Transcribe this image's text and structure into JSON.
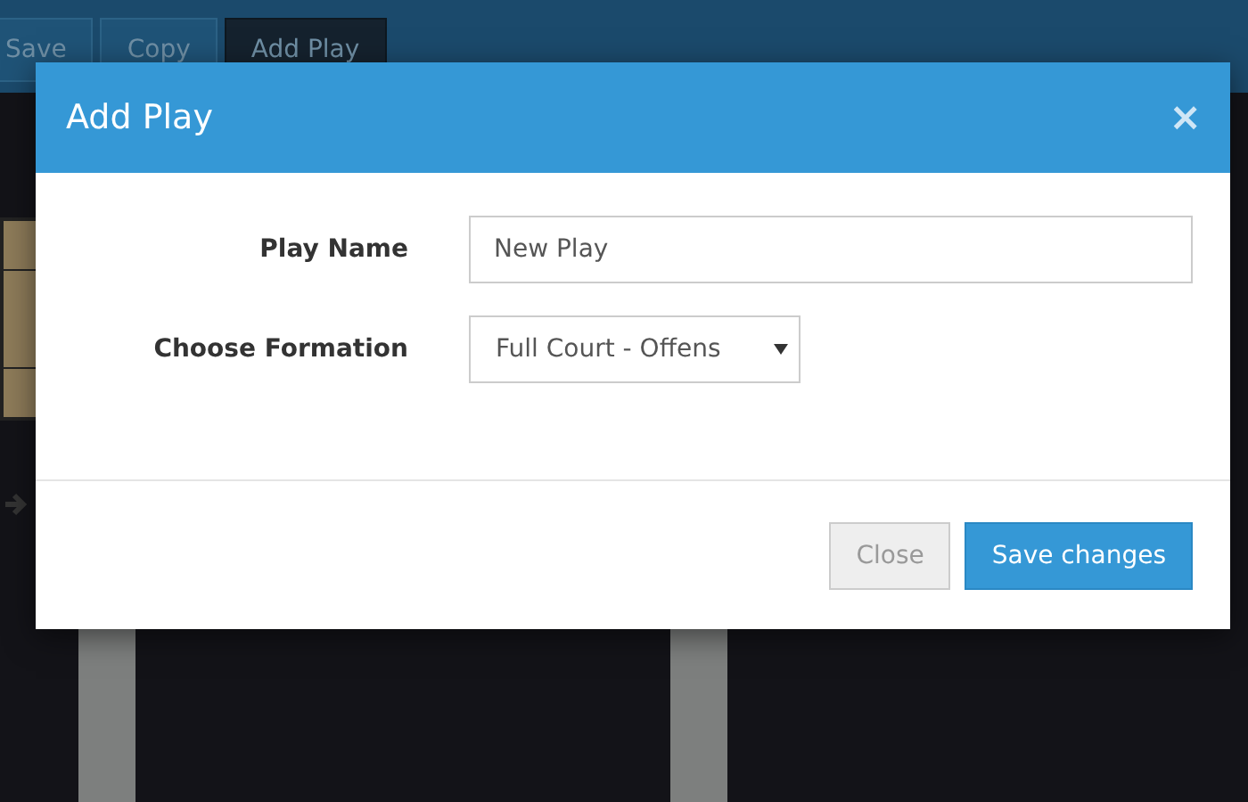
{
  "toolbar": {
    "buttons": [
      {
        "label": "Save",
        "selected": false
      },
      {
        "label": "Copy",
        "selected": false
      },
      {
        "label": "Add Play",
        "selected": true
      }
    ]
  },
  "dialog": {
    "title": "Add Play",
    "close_icon": "×",
    "fields": [
      {
        "kind": "text",
        "label": "Play Name",
        "value": "New Play"
      },
      {
        "kind": "select",
        "label": "Choose Formation",
        "value": "Full Court - Offens"
      }
    ],
    "buttons": [
      {
        "label": "Close",
        "kind": "secondary"
      },
      {
        "label": "Save changes",
        "kind": "primary"
      }
    ]
  }
}
